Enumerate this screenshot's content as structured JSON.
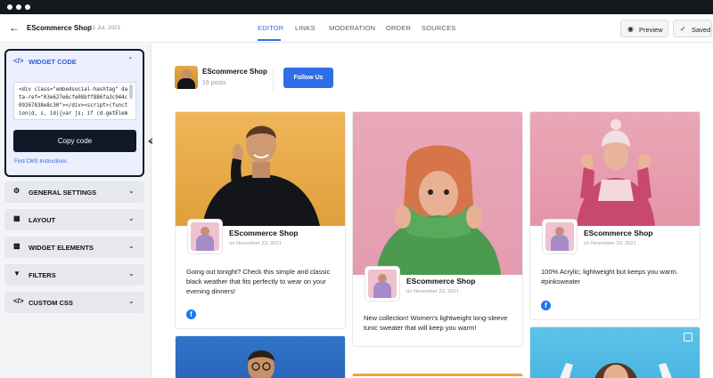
{
  "topbar": {
    "back_icon": "arrow-left-icon",
    "shop_name": "EScommerce Shop",
    "date": "21 Jul, 2021",
    "tabs": [
      "EDITOR",
      "LINKS",
      "MODERATION",
      "ORDER",
      "SOURCES"
    ],
    "active_tab": "EDITOR",
    "preview_label": "Preview",
    "saved_label": "Saved"
  },
  "sidebar": {
    "widget_code": {
      "title": "WIDGET CODE",
      "code": "<div class=\"embedsocial-hashtag\" data-ref=\"03e627e6cfe08bff886fa3c944c09267838e8c30\"></div><script>(function(d, s, id){var js; if (d.getEleme",
      "copy_label": "Copy code",
      "cms_link": "Find CMS Instructions"
    },
    "sections": [
      {
        "label": "GENERAL SETTINGS",
        "icon": "gear-icon"
      },
      {
        "label": "LAYOUT",
        "icon": "grid-icon"
      },
      {
        "label": "WIDGET ELEMENTS",
        "icon": "elements-icon"
      },
      {
        "label": "FILTERS",
        "icon": "filter-icon"
      },
      {
        "label": "CUSTOM CSS",
        "icon": "code-icon"
      }
    ]
  },
  "feed_header": {
    "name": "EScommerce Shop",
    "posts": "16 posts",
    "follow_label": "Follow Us"
  },
  "posts": [
    {
      "name": "EScommerce Shop",
      "date": "on November 23, 2021",
      "text": "Going out tonight? Check this simple and classic black weather that fits perfectly to wear on your evening dinners!"
    },
    {
      "name": "EScommerce Shop",
      "date": "on November 23, 2021",
      "text": "New collection! Women's lightweight long-sleeve tunic sweater that will keep you warm!"
    },
    {
      "name": "EScommerce Shop",
      "date": "on November 23, 2021",
      "text": "100% Acrylic; lightweight but keeps you warm. #pinksweater"
    }
  ],
  "colors": {
    "accent": "#2f6ee8",
    "dark": "#111827",
    "facebook": "#1877f2"
  }
}
